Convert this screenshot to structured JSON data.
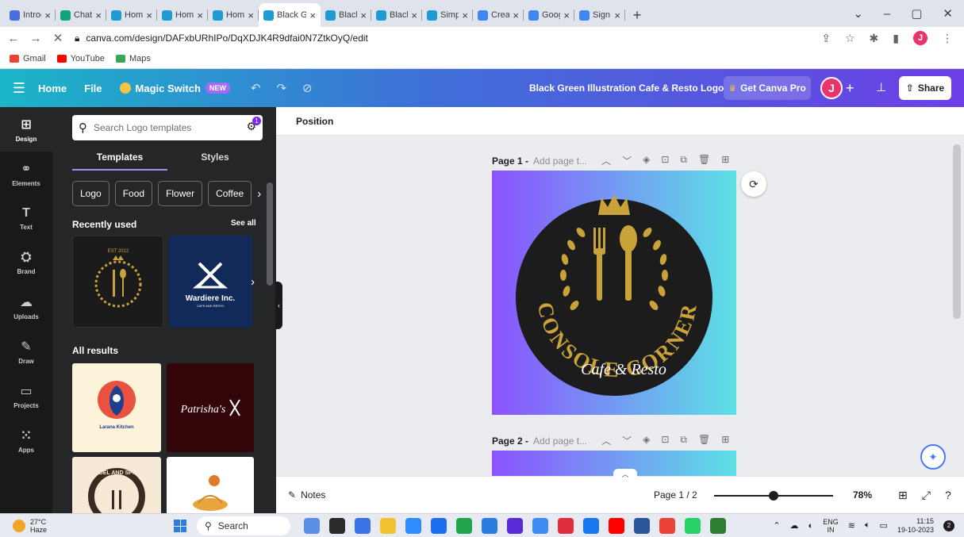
{
  "browser": {
    "tabs": [
      {
        "label": "Introdu",
        "color": "#4a6ee0"
      },
      {
        "label": "ChatGI",
        "color": "#10a37f"
      },
      {
        "label": "Home",
        "color": "#1f9bd3"
      },
      {
        "label": "Home",
        "color": "#1f9bd3"
      },
      {
        "label": "Home",
        "color": "#1f9bd3"
      },
      {
        "label": "Black G",
        "color": "#1f9bd3",
        "active": true
      },
      {
        "label": "Black C",
        "color": "#1f9bd3"
      },
      {
        "label": "Black C",
        "color": "#1f9bd3"
      },
      {
        "label": "Simple",
        "color": "#1f9bd3"
      },
      {
        "label": "Create",
        "color": "#4285f4"
      },
      {
        "label": "Google",
        "color": "#4285f4"
      },
      {
        "label": "Sign in",
        "color": "#4285f4"
      }
    ],
    "new_tab": "+",
    "url": "canva.com/design/DAFxbURhIPo/DqXDJK4R9dfai0N7ZtkOyQ/edit",
    "profile_initial": "J",
    "bookmarks": [
      {
        "label": "Gmail",
        "color": "#ea4335"
      },
      {
        "label": "YouTube",
        "color": "#ff0000"
      },
      {
        "label": "Maps",
        "color": "#34a853"
      }
    ]
  },
  "canva_header": {
    "home": "Home",
    "file": "File",
    "magic_switch": "Magic Switch",
    "new_badge": "NEW",
    "doc_title": "Black Green Illustration Cafe & Resto Logo",
    "get_pro": "Get Canva Pro",
    "user_initial": "J",
    "share": "Share"
  },
  "rail": [
    {
      "label": "Design",
      "icon": "⊞",
      "active": true
    },
    {
      "label": "Elements",
      "icon": "⚭"
    },
    {
      "label": "Text",
      "icon": "T"
    },
    {
      "label": "Brand",
      "icon": "⛭"
    },
    {
      "label": "Uploads",
      "icon": "☁"
    },
    {
      "label": "Draw",
      "icon": "✎"
    },
    {
      "label": "Projects",
      "icon": "▭"
    },
    {
      "label": "Apps",
      "icon": "⁙"
    }
  ],
  "panel": {
    "search_placeholder": "Search Logo templates",
    "filter_count": "1",
    "tabs": {
      "templates": "Templates",
      "styles": "Styles"
    },
    "chips": [
      "Logo",
      "Food",
      "Flower",
      "Coffee"
    ],
    "recently_used": "Recently used",
    "see_all": "See all",
    "all_results": "All results",
    "thumbs": {
      "cafe_est": "EST 2012",
      "wardiere_name": "Wardiere Inc.",
      "wardiere_sub": "CAFE AND RESTO",
      "larana": "Larana Kitchen",
      "patrisha": "Patrisha's",
      "fadel": "FADEL AND SPIES"
    }
  },
  "workspace": {
    "toolbar_label": "Position",
    "page1_label": "Page 1 -",
    "page1_title_placeholder": "Add page t...",
    "page2_label": "Page 2 -",
    "page2_title_placeholder": "Add page t...",
    "logo": {
      "name_top": "CONSOLE CORNER",
      "tagline": "Cafe & Resto",
      "gold": "#c9a23a",
      "circle": "#1c1c1c"
    }
  },
  "bottombar": {
    "notes": "Notes",
    "page_indicator": "Page 1 / 2",
    "zoom": "78%",
    "zoom_fraction": 0.5
  },
  "taskbar": {
    "temp": "27°C",
    "condition": "Haze",
    "search": "Search",
    "apps": [
      "#5b8ee6",
      "#2b2b2b",
      "#3a73e8",
      "#f2c230",
      "#2d8cff",
      "#1d6ef0",
      "#1fa64a",
      "#2a7de1",
      "#5a2ad8",
      "#3d8cf5",
      "#e12e3c",
      "#1877f2",
      "#ff0000",
      "#2b579a",
      "#ea4335",
      "#25d366",
      "#2e7d32"
    ],
    "lang_top": "ENG",
    "lang_bottom": "IN",
    "time": "11:15",
    "date": "19-10-2023",
    "notif_count": "2"
  }
}
